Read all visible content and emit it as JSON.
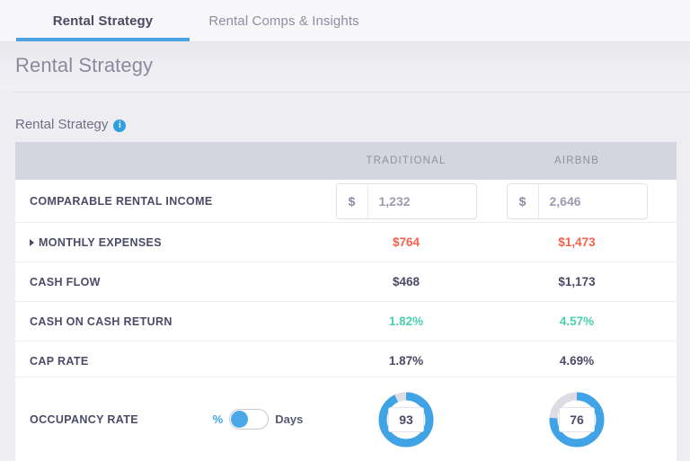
{
  "tabs": [
    {
      "label": "Rental Strategy",
      "active": true
    },
    {
      "label": "Rental Comps & Insights",
      "active": false
    }
  ],
  "page": {
    "title": "Rental Strategy"
  },
  "section": {
    "label": "Rental Strategy",
    "info_icon": "info-icon",
    "info_glyph": "i"
  },
  "table": {
    "columns": {
      "label": "",
      "traditional": "TRADITIONAL",
      "airbnb": "AIRBNB"
    },
    "rows": [
      {
        "name": "COMPARABLE RENTAL INCOME",
        "type": "input",
        "traditional": {
          "prefix": "$",
          "value": "1,232"
        },
        "airbnb": {
          "prefix": "$",
          "value": "2,646"
        }
      },
      {
        "name": "MONTHLY EXPENSES",
        "type": "value",
        "expandable": true,
        "traditional": "$764",
        "airbnb": "$1,473",
        "tone": "negative"
      },
      {
        "name": "CASH FLOW",
        "type": "value",
        "traditional": "$468",
        "airbnb": "$1,173",
        "tone": "neutral"
      },
      {
        "name": "CASH ON CASH RETURN",
        "type": "value",
        "traditional": "1.82%",
        "airbnb": "4.57%",
        "tone": "positive"
      },
      {
        "name": "CAP RATE",
        "type": "value",
        "traditional": "1.87%",
        "airbnb": "4.69%",
        "tone": "neutral"
      }
    ]
  },
  "occupancy": {
    "label": "OCCUPANCY RATE",
    "toggle": {
      "left_label": "%",
      "right_label": "Days",
      "selected": "%"
    },
    "traditional": {
      "value": "93",
      "percent": 93
    },
    "airbnb": {
      "value": "76",
      "percent": 76
    }
  },
  "colors": {
    "accent_blue": "#4aa3e0",
    "negative_red": "#f7604b",
    "positive_green": "#4ccfae",
    "text_dark": "#4b4b68",
    "header_band": "#d5d5e0"
  }
}
